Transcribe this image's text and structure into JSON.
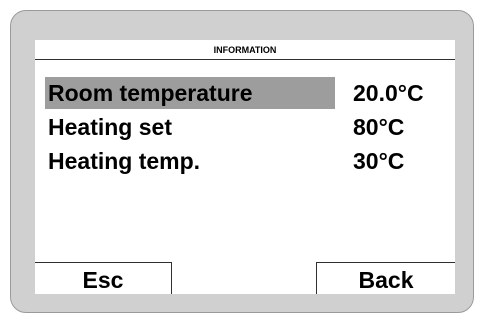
{
  "screen": {
    "title": "INFORMATION"
  },
  "rows": [
    {
      "label": "Room temperature",
      "value": "20.0°C",
      "selected": true
    },
    {
      "label": "Heating set",
      "value": "80°C",
      "selected": false
    },
    {
      "label": "Heating temp.",
      "value": "30°C",
      "selected": false
    }
  ],
  "softkeys": {
    "left_label": "Esc",
    "right_label": "Back"
  },
  "colors": {
    "bezel": "#d0d0d0",
    "screen_background": "#ffffff",
    "selection_highlight": "#9d9d9d",
    "text": "#000000"
  }
}
